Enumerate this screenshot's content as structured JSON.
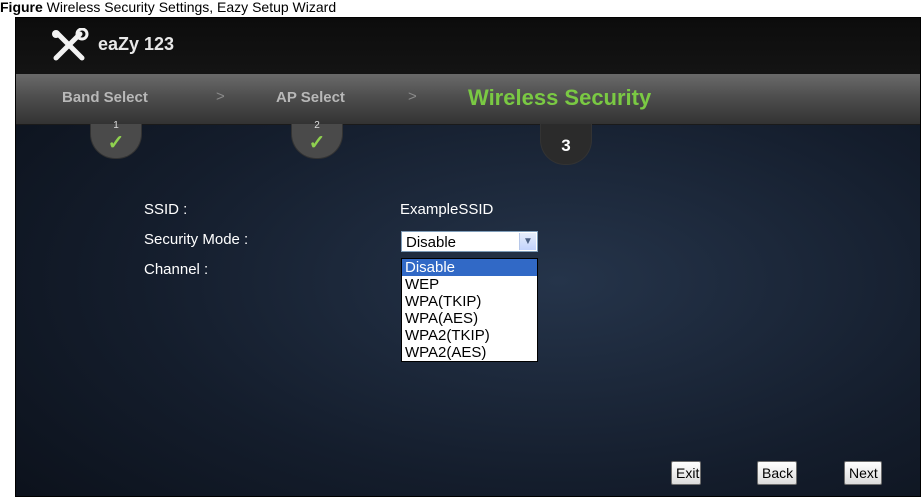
{
  "caption": {
    "label": "Figure",
    "text": "Wireless Security Settings, Eazy Setup Wizard"
  },
  "app": {
    "logo_icon": "tools-icon",
    "title": "eaZy 123"
  },
  "wizard": {
    "steps": [
      {
        "label": "Band Select",
        "number": "1",
        "status": "done"
      },
      {
        "label": "AP Select",
        "number": "2",
        "status": "done"
      },
      {
        "label": "Wireless Security",
        "number": "3",
        "status": "current"
      }
    ],
    "separator": ">"
  },
  "form": {
    "ssid_label": "SSID :",
    "ssid_value": "ExampleSSID",
    "security_mode_label": "Security Mode :",
    "channel_label": "Channel :",
    "security_mode_selected": "Disable",
    "security_mode_options": [
      "Disable",
      "WEP",
      "WPA(TKIP)",
      "WPA(AES)",
      "WPA2(TKIP)",
      "WPA2(AES)"
    ]
  },
  "buttons": {
    "exit": "Exit",
    "back": "Back",
    "next": "Next"
  },
  "colors": {
    "active_step": "#7ac943",
    "check": "#8fd14f",
    "selected_option": "#3169c6"
  }
}
